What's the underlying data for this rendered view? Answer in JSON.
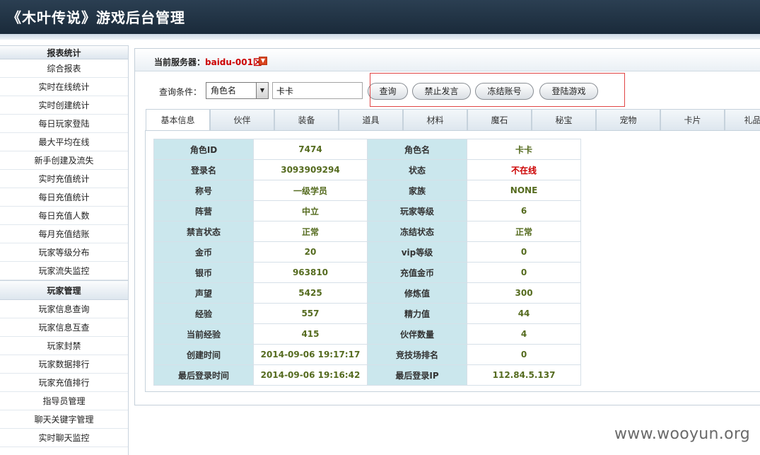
{
  "header": {
    "title": "《木叶传说》游戏后台管理"
  },
  "sidebar": {
    "sections": [
      {
        "title": "报表统计",
        "items": [
          "综合报表",
          "实时在线统计",
          "实时创建统计",
          "每日玩家登陆",
          "最大平均在线",
          "新手创建及流失",
          "实时充值统计",
          "每日充值统计",
          "每日充值人数",
          "每月充值结账",
          "玩家等级分布",
          "玩家流失监控"
        ]
      },
      {
        "title": "玩家管理",
        "items": [
          "玩家信息查询",
          "玩家信息互查",
          "玩家封禁",
          "玩家数据排行",
          "玩家充值排行",
          "指导员管理",
          "聊天关键字管理",
          "实时聊天监控"
        ]
      }
    ]
  },
  "server": {
    "label": "当前服务器：",
    "name": "baidu-001区"
  },
  "query": {
    "label": "查询条件：",
    "select_value": "角色名",
    "input_value": "卡卡",
    "buttons": [
      "查询",
      "禁止发言",
      "冻结账号",
      "登陆游戏"
    ]
  },
  "tabs": [
    "基本信息",
    "伙伴",
    "装备",
    "道具",
    "材料",
    "魔石",
    "秘宝",
    "宠物",
    "卡片",
    "礼品卡"
  ],
  "info_rows": [
    [
      "角色ID",
      "7474",
      "角色名",
      "卡卡"
    ],
    [
      "登录名",
      "3093909294",
      "状态",
      "不在线"
    ],
    [
      "称号",
      "一级学员",
      "家族",
      "NONE"
    ],
    [
      "阵营",
      "中立",
      "玩家等级",
      "6"
    ],
    [
      "禁言状态",
      "正常",
      "冻结状态",
      "正常"
    ],
    [
      "金币",
      "20",
      "vip等级",
      "0"
    ],
    [
      "银币",
      "963810",
      "充值金币",
      "0"
    ],
    [
      "声望",
      "5425",
      "修炼值",
      "300"
    ],
    [
      "经验",
      "557",
      "精力值",
      "44"
    ],
    [
      "当前经验",
      "415",
      "伙伴数量",
      "4"
    ],
    [
      "创建时间",
      "2014-09-06 19:17:17",
      "竞技场排名",
      "0"
    ],
    [
      "最后登录时间",
      "2014-09-06 19:16:42",
      "最后登录IP",
      "112.84.5.137"
    ]
  ],
  "watermark": "www.wooyun.org",
  "colors": {
    "header_bg": "#1f3142",
    "key_cell_bg": "#cbe7ed",
    "value_text": "#556b1f",
    "offline_text": "#cc0000"
  }
}
